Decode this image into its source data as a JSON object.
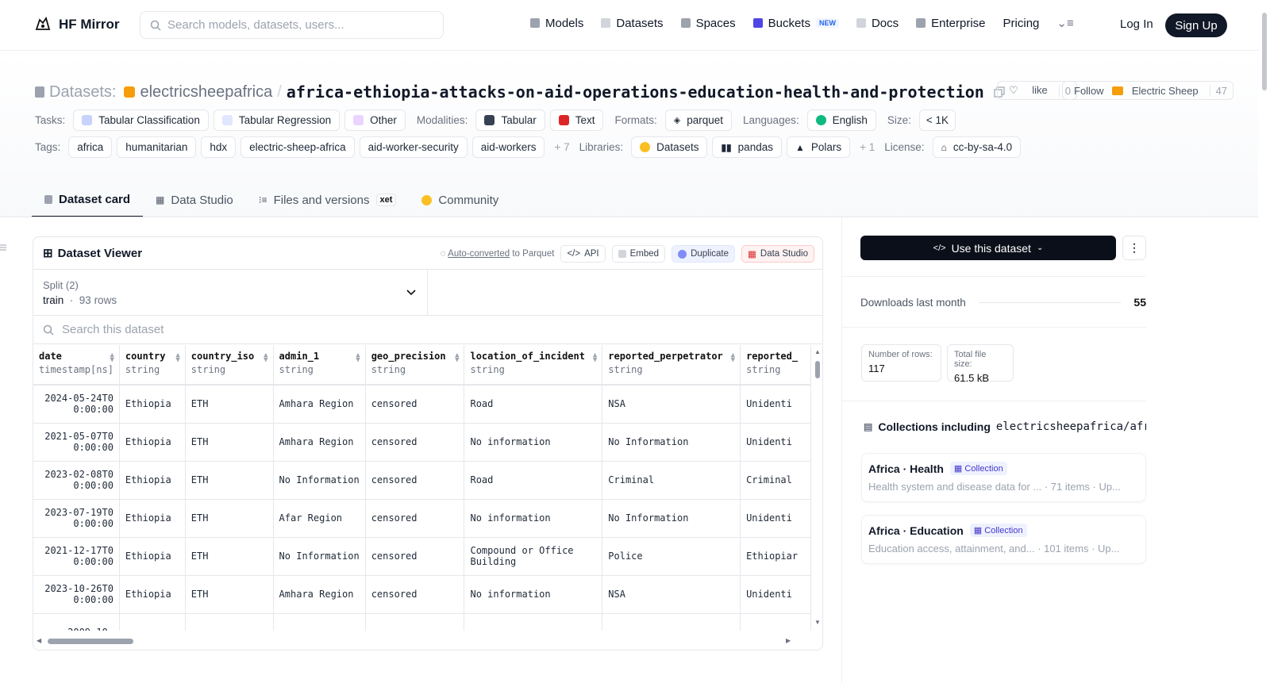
{
  "nav": {
    "brand": "HF Mirror",
    "search_placeholder": "Search models, datasets, users...",
    "links": [
      "Models",
      "Datasets",
      "Spaces",
      "Buckets",
      "Docs",
      "Enterprise",
      "Pricing"
    ],
    "buckets_badge": "NEW",
    "login": "Log In",
    "signup": "Sign Up"
  },
  "header": {
    "prefix": "Datasets:",
    "owner": "electricsheepafrica",
    "slash": "/",
    "name": "africa-ethiopia-attacks-on-aid-operations-education-health-and-protection",
    "like_label": "like",
    "like_count": "0",
    "follow_label": "Follow",
    "follow_name": "Electric Sheep",
    "follow_count": "47"
  },
  "tags_row1": {
    "tasks_label": "Tasks:",
    "tasks": [
      "Tabular Classification",
      "Tabular Regression",
      "Other"
    ],
    "modalities_label": "Modalities:",
    "modalities": [
      "Tabular",
      "Text"
    ],
    "formats_label": "Formats:",
    "formats": [
      "parquet"
    ],
    "languages_label": "Languages:",
    "languages": [
      "English"
    ],
    "size_label": "Size:",
    "size": "< 1K"
  },
  "tags_row2": {
    "tags_label": "Tags:",
    "tags": [
      "africa",
      "humanitarian",
      "hdx",
      "electric-sheep-africa",
      "aid-worker-security",
      "aid-workers"
    ],
    "tags_more": "+ 7",
    "libraries_label": "Libraries:",
    "libraries": [
      "Datasets",
      "pandas",
      "Polars"
    ],
    "libraries_more": "+ 1",
    "license_label": "License:",
    "license": "cc-by-sa-4.0"
  },
  "tabs": [
    "Dataset card",
    "Data Studio",
    "Files and versions",
    "Community"
  ],
  "tab_xet": "xet",
  "viewer": {
    "title": "Dataset Viewer",
    "auto_converted": "Auto-converted",
    "to_parquet": "to Parquet",
    "api": "API",
    "embed": "Embed",
    "duplicate": "Duplicate",
    "data_studio": "Data Studio",
    "split_label": "Split (2)",
    "split_value": "train",
    "split_rows": "93 rows",
    "search_placeholder": "Search this dataset",
    "columns": [
      {
        "name": "date",
        "type": "timestamp[ns]"
      },
      {
        "name": "country",
        "type": "string"
      },
      {
        "name": "country_iso",
        "type": "string"
      },
      {
        "name": "admin_1",
        "type": "string"
      },
      {
        "name": "geo_precision",
        "type": "string"
      },
      {
        "name": "location_of_incident",
        "type": "string"
      },
      {
        "name": "reported_perpetrator",
        "type": "string"
      },
      {
        "name": "reported_",
        "type": "string"
      }
    ],
    "rows": [
      [
        "2024-05-24T00:00:00",
        "Ethiopia",
        "ETH",
        "Amhara Region",
        "censored",
        "Road",
        "NSA",
        "Unidenti"
      ],
      [
        "2021-05-07T00:00:00",
        "Ethiopia",
        "ETH",
        "Amhara Region",
        "censored",
        "No information",
        "No Information",
        "Unidenti"
      ],
      [
        "2023-02-08T00:00:00",
        "Ethiopia",
        "ETH",
        "No Information",
        "censored",
        "Road",
        "Criminal",
        "Criminal"
      ],
      [
        "2023-07-19T00:00:00",
        "Ethiopia",
        "ETH",
        "Afar Region",
        "censored",
        "No information",
        "No Information",
        "Unidenti"
      ],
      [
        "2021-12-17T00:00:00",
        "Ethiopia",
        "ETH",
        "No Information",
        "censored",
        "Compound or Office Building",
        "Police",
        "Ethiopiar"
      ],
      [
        "2023-10-26T00:00:00",
        "Ethiopia",
        "ETH",
        "Amhara Region",
        "censored",
        "No information",
        "NSA",
        "Unidenti"
      ],
      [
        "2009-10-",
        "",
        "",
        "",
        "",
        "",
        "",
        ""
      ]
    ]
  },
  "sidebar": {
    "use_button": "Use this dataset",
    "downloads_label": "Downloads last month",
    "downloads_value": "55",
    "rows_label": "Number of rows:",
    "rows_value": "117",
    "size_label": "Total file size:",
    "size_value": "61.5 kB",
    "collections_title": "Collections including",
    "collections_repo": "electricsheepafrica/afr...",
    "collections": [
      {
        "title": "Africa · Health",
        "badge": "Collection",
        "desc": "Health system and disease data for ... · 71 items · Up..."
      },
      {
        "title": "Africa · Education",
        "badge": "Collection",
        "desc": "Education access, attainment, and... · 101 items · Up..."
      }
    ]
  },
  "colors": {
    "brand_dark": "#111827",
    "accent_orange": "#f59e0b",
    "indigo": "#6366f1",
    "red": "#dc2626"
  }
}
